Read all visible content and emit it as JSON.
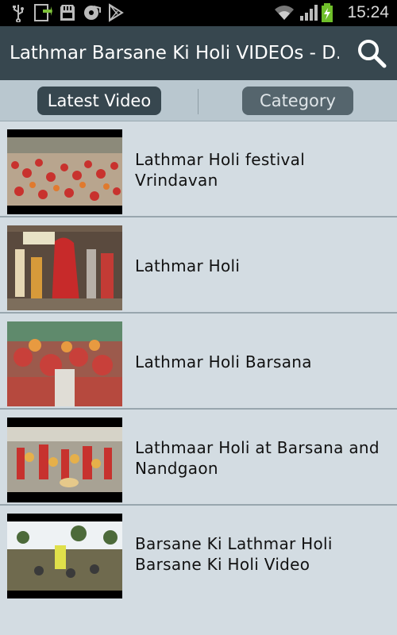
{
  "status_bar": {
    "time": "15:24",
    "icons": [
      "usb-icon",
      "download-icon",
      "sd-card-icon",
      "media-icon",
      "play-store-icon",
      "wifi-icon",
      "signal-icon",
      "battery-charging-icon"
    ]
  },
  "app_bar": {
    "title": "Lathmar Barsane Ki Holi VIDEOs - D...",
    "search_icon": "search-icon"
  },
  "tabs": [
    {
      "label": "Latest Video",
      "selected": true
    },
    {
      "label": "Category",
      "selected": false
    }
  ],
  "videos": [
    {
      "title": "Lathmar Holi festival Vrindavan"
    },
    {
      "title": "Lathmar Holi"
    },
    {
      "title": "Lathmar Holi Barsana"
    },
    {
      "title": "Lathmaar Holi at Barsana and Nandgaon"
    },
    {
      "title": "Barsane Ki Lathmar Holi Barsane Ki Holi Video"
    }
  ],
  "colors": {
    "app_bar": "#37474f",
    "background": "#d3dce2",
    "tab_bar": "#b9c7cf",
    "tab_selected": "#37474f",
    "tab_unselected": "#55656d"
  }
}
